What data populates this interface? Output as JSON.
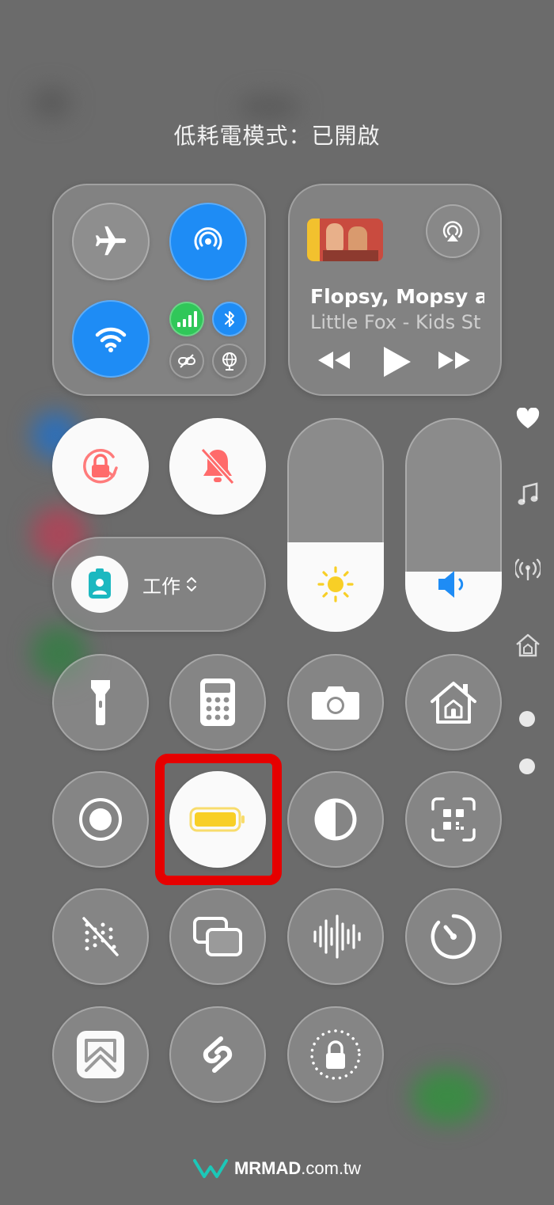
{
  "status": {
    "text": "低耗電模式：已開啟"
  },
  "now_playing": {
    "title": "Flopsy, Mopsy an",
    "artist": "Little Fox - Kids St",
    "artwork_icon": "album-artwork"
  },
  "focus": {
    "label": "工作",
    "icon": "id-badge-icon",
    "chevron": "⌃⌄"
  },
  "sliders": {
    "brightness_level": 0.42,
    "volume_level": 0.28
  },
  "colors": {
    "accent_blue": "#1e8cf5",
    "green": "#30c759",
    "battery_yellow": "#f8cf26",
    "lock_red": "#ff6b6b",
    "highlight": "#e60000"
  },
  "watermark": {
    "brand": "MRMAD",
    "domain": ".com.tw"
  },
  "side_rail": [
    "heart-icon",
    "music-note-icon",
    "antenna-icon",
    "home-icon",
    "page-dot",
    "page-dot"
  ]
}
